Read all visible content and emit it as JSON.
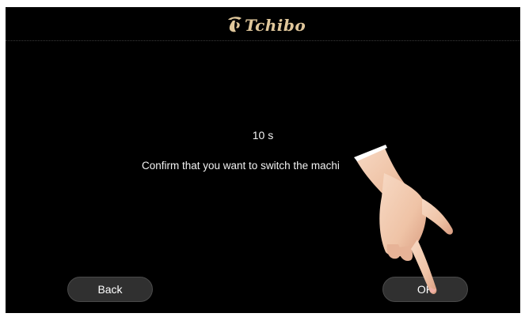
{
  "header": {
    "brand": "Tchibo",
    "logo_icon": "tchibo-cup-mark-icon",
    "brand_color": "#e0c79b"
  },
  "dialog": {
    "countdown": "10 s",
    "message": "Confirm that you want to switch the machi"
  },
  "buttons": {
    "back_label": "Back",
    "ok_label": "OK"
  },
  "overlay": {
    "pointer_icon": "pointing-hand-icon"
  },
  "colors": {
    "screen_background": "#000000",
    "button_background": "#303030",
    "text": "#f2f2f2"
  }
}
